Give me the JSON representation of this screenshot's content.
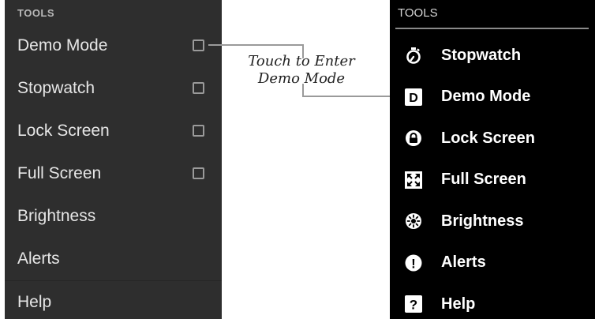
{
  "left_panel": {
    "header": "TOOLS",
    "items": [
      {
        "label": "Demo Mode",
        "has_checkbox": true
      },
      {
        "label": "Stopwatch",
        "has_checkbox": true
      },
      {
        "label": "Lock Screen",
        "has_checkbox": true
      },
      {
        "label": "Full Screen",
        "has_checkbox": true
      },
      {
        "label": "Brightness",
        "has_checkbox": false
      },
      {
        "label": "Alerts",
        "has_checkbox": false
      },
      {
        "label": "Help",
        "has_checkbox": false
      }
    ]
  },
  "callout": {
    "line1": "Touch to Enter",
    "line2": "Demo Mode"
  },
  "right_panel": {
    "header": "TOOLS",
    "items": [
      {
        "label": "Stopwatch",
        "icon": "stopwatch-icon"
      },
      {
        "label": "Demo Mode",
        "icon": "demo-mode-icon",
        "icon_text": "D"
      },
      {
        "label": "Lock Screen",
        "icon": "lock-icon"
      },
      {
        "label": "Full Screen",
        "icon": "full-screen-icon"
      },
      {
        "label": "Brightness",
        "icon": "brightness-icon"
      },
      {
        "label": "Alerts",
        "icon": "alert-icon",
        "icon_text": "!"
      },
      {
        "label": "Help",
        "icon": "help-icon",
        "icon_text": "?"
      }
    ]
  },
  "colors": {
    "left_background": "#2e2e2e",
    "right_background": "#000000",
    "text_primary": "#ffffff",
    "callout_line": "#9a9a9a"
  }
}
